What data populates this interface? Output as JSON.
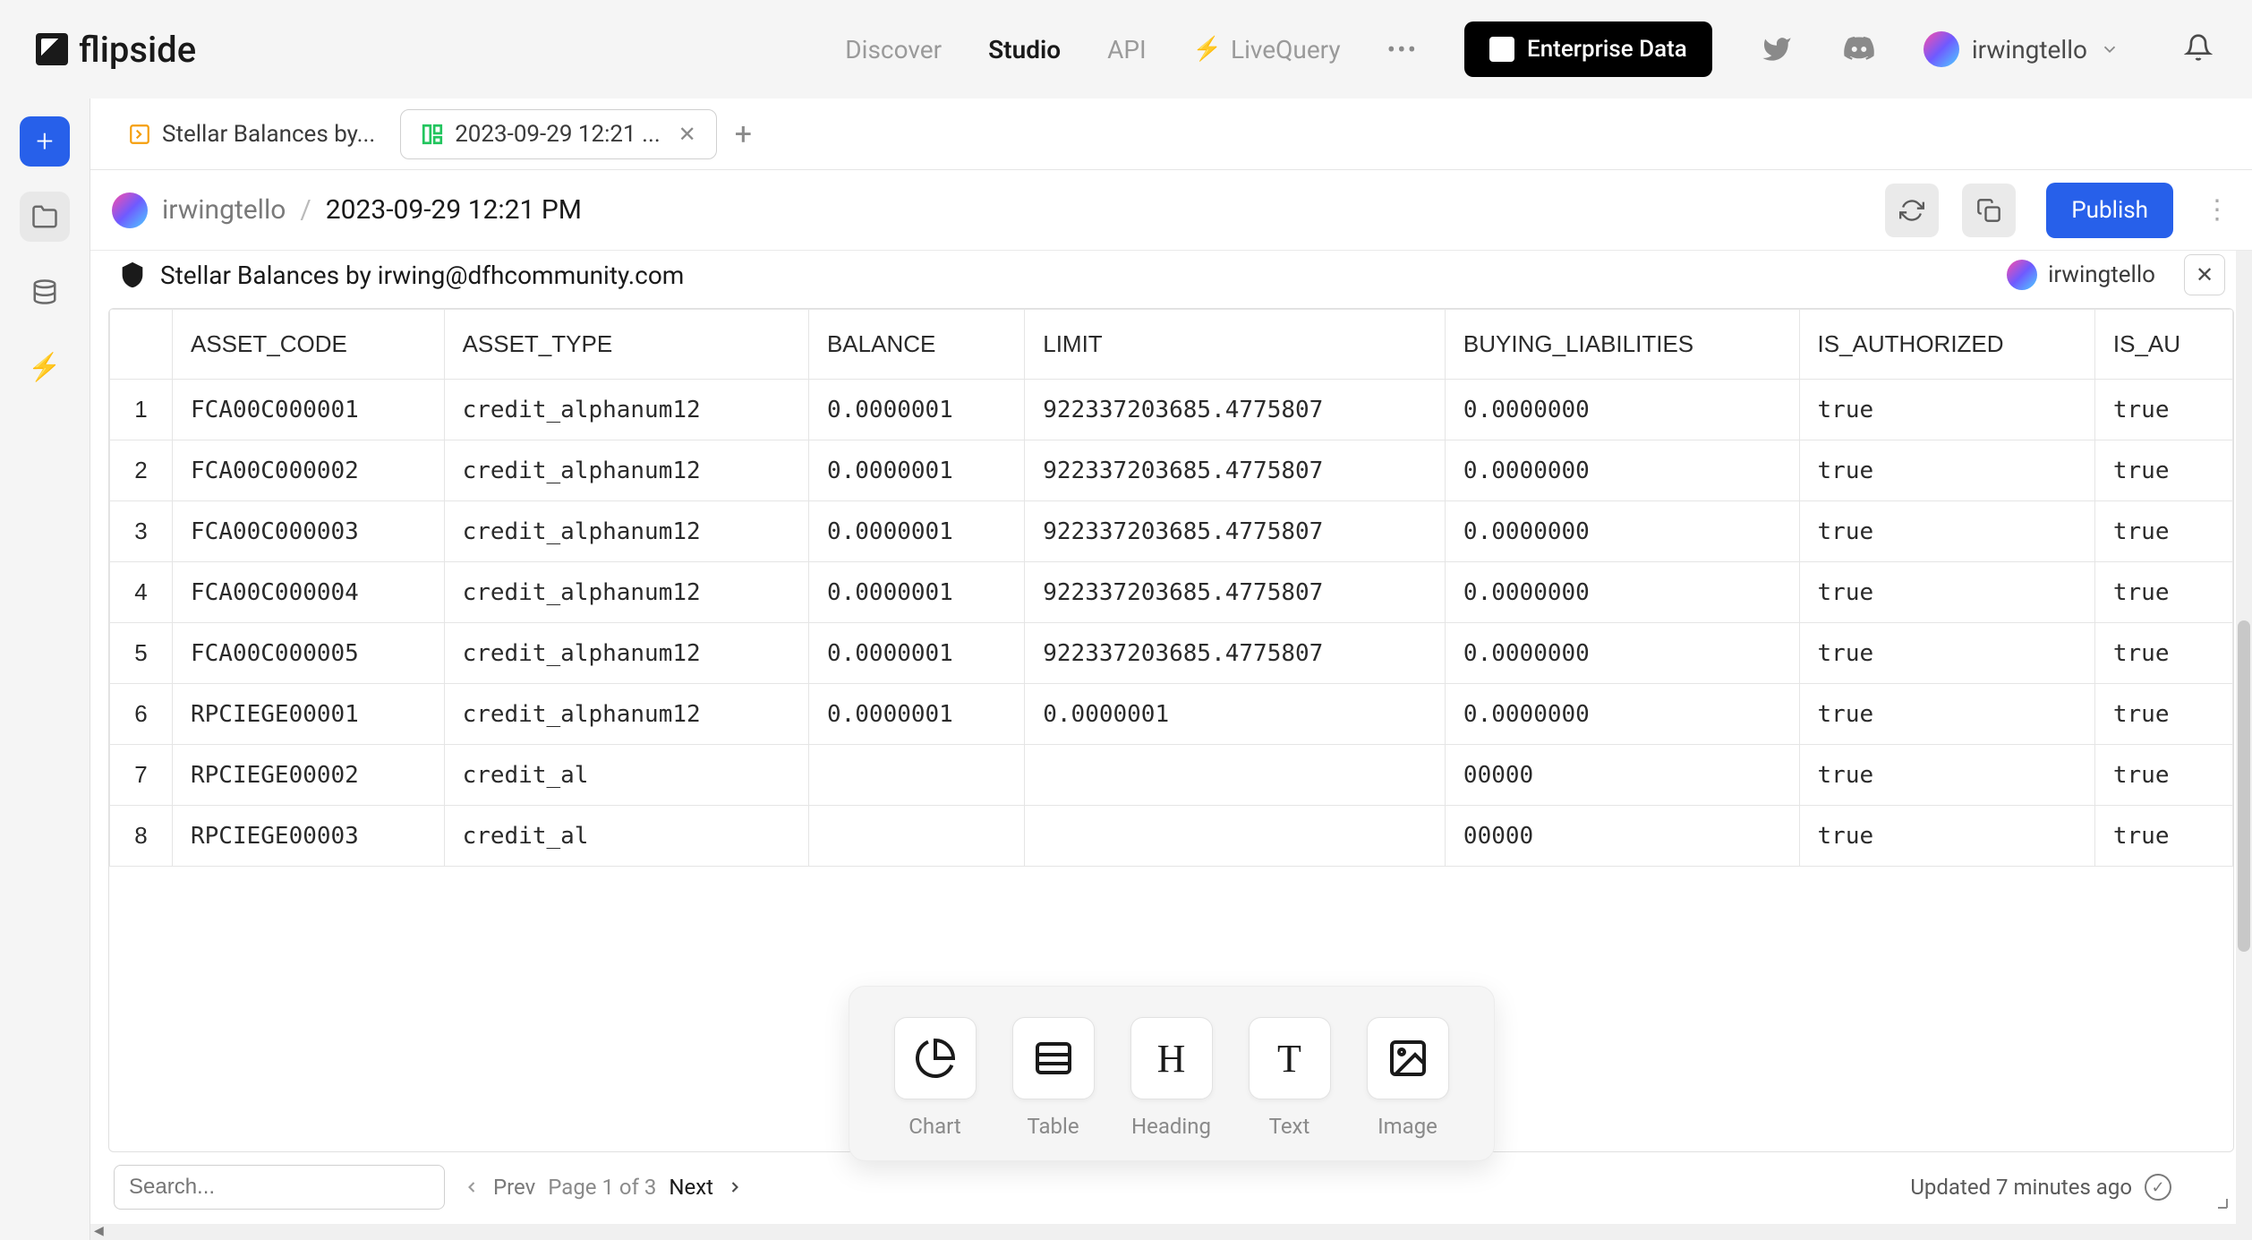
{
  "brand": "flipside",
  "nav": {
    "discover": "Discover",
    "studio": "Studio",
    "api": "API",
    "livequery": "LiveQuery",
    "enterprise": "Enterprise Data"
  },
  "user": {
    "name": "irwingtello"
  },
  "tabs": [
    {
      "label": "Stellar Balances by..."
    },
    {
      "label": "2023-09-29 12:21 ..."
    }
  ],
  "breadcrumb": {
    "user": "irwingtello",
    "title": "2023-09-29 12:21 PM",
    "publish": "Publish"
  },
  "panel": {
    "title": "Stellar Balances by irwing@dfhcommunity.com",
    "user": "irwingtello"
  },
  "table": {
    "headers": [
      "",
      "ASSET_CODE",
      "ASSET_TYPE",
      "BALANCE",
      "LIMIT",
      "BUYING_LIABILITIES",
      "IS_AUTHORIZED",
      "IS_AU"
    ],
    "rows": [
      [
        "1",
        "FCA00C000001",
        "credit_alphanum12",
        "0.0000001",
        "922337203685.4775807",
        "0.0000000",
        "true",
        "true"
      ],
      [
        "2",
        "FCA00C000002",
        "credit_alphanum12",
        "0.0000001",
        "922337203685.4775807",
        "0.0000000",
        "true",
        "true"
      ],
      [
        "3",
        "FCA00C000003",
        "credit_alphanum12",
        "0.0000001",
        "922337203685.4775807",
        "0.0000000",
        "true",
        "true"
      ],
      [
        "4",
        "FCA00C000004",
        "credit_alphanum12",
        "0.0000001",
        "922337203685.4775807",
        "0.0000000",
        "true",
        "true"
      ],
      [
        "5",
        "FCA00C000005",
        "credit_alphanum12",
        "0.0000001",
        "922337203685.4775807",
        "0.0000000",
        "true",
        "true"
      ],
      [
        "6",
        "RPCIEGE00001",
        "credit_alphanum12",
        "0.0000001",
        "0.0000001",
        "0.0000000",
        "true",
        "true"
      ],
      [
        "7",
        "RPCIEGE00002",
        "credit_al",
        "",
        "",
        "00000",
        "true",
        "true"
      ],
      [
        "8",
        "RPCIEGE00003",
        "credit_al",
        "",
        "",
        "00000",
        "true",
        "true"
      ]
    ]
  },
  "footer": {
    "search_placeholder": "Search...",
    "prev": "Prev",
    "page_info": "Page 1 of 3",
    "next": "Next",
    "updated": "Updated 7 minutes ago"
  },
  "tools": {
    "chart": "Chart",
    "table": "Table",
    "heading": "Heading",
    "text": "Text",
    "image": "Image"
  }
}
